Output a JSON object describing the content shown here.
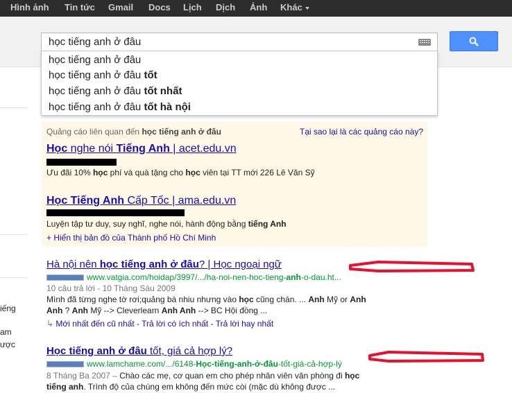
{
  "topnav": [
    {
      "label": "Hình ảnh"
    },
    {
      "label": "Tin tức"
    },
    {
      "label": "Gmail"
    },
    {
      "label": "Docs"
    },
    {
      "label": "Lịch"
    },
    {
      "label": "Dịch"
    },
    {
      "label": "Ảnh"
    },
    {
      "label": "Khác"
    }
  ],
  "search": {
    "value": "học tiếng anh ở đâu"
  },
  "suggestions": [
    {
      "base": "học tiếng anh ở đâu",
      "bold": ""
    },
    {
      "base": "học tiếng anh ở đâu ",
      "bold": "tốt"
    },
    {
      "base": "học tiếng anh ở đâu ",
      "bold": "tốt nhất"
    },
    {
      "base": "học tiếng anh ở đâu ",
      "bold": "tốt hà nội"
    }
  ],
  "left_fragments": [
    "iếng",
    "am",
    "ược"
  ],
  "ads": {
    "header_prefix": "Quảng cáo liên quan đến ",
    "header_query": "học tiếng anh ở đâu",
    "why": "Tại sao lại là các quảng cáo này?",
    "items": [
      {
        "t1": "Học",
        "t2": " nghe nói ",
        "t3": "Tiếng Anh",
        "t4": " | acet.edu.vn",
        "d1": "Ưu đãi 10% ",
        "d2": "học",
        "d3": " phí và quà tặng cho ",
        "d4": "học",
        "d5": " viên tại TT mới 226 Lê Văn Sỹ"
      },
      {
        "t1": "Học Tiếng Anh",
        "t2": " Cấp Tốc | ama.edu.vn",
        "d1": "Luyện tập tư duy, suy nghĩ, nghe nói, hành động bằng ",
        "d2": "tiếng Anh"
      }
    ],
    "map_link": "+ Hiển thị bản đồ của Thành phố Hồ Chí Minh"
  },
  "results": [
    {
      "title_a": "Hà nội nên ",
      "title_b": "học tiếng anh ở đâu",
      "title_c": "? | Học ngoại ngữ",
      "url_a": "www.vatgia.com/hoidap/3997/.../ha-noi-nen-hoc-tieng-",
      "url_b": "anh",
      "url_c": "-o-dau.ht...",
      "meta": "10 câu trả lời - 10 Tháng Sáu 2009",
      "s1a": "Mình đã từng nghe tờ rơi;quảng bá nhiu nhưng vào ",
      "s1b": "học",
      "s1c": " cũng chán. ... ",
      "s1d": "Anh",
      "s1e": " Mỹ or ",
      "s1f": "Anh",
      "s2a": "Anh",
      "s2b": " ? ",
      "s2c": "Anh",
      "s2d": " Mỹ --> Cleverlearn ",
      "s2e": "Anh Anh",
      "s2f": " --> BC Hội đồng ...",
      "links": "Mới nhất đến cũ nhất - Trả lời có ích nhất - Trả lời hay nhất"
    },
    {
      "title_a": "Học tiếng anh ở đâu",
      "title_b": " tốt, giá cả hợp lý?",
      "url_a": "www.lamchame.com/.../6148-",
      "url_b": "Học-tiếng-anh-ở-đâu",
      "url_c": "-tốt-giá-cả-hợp-lý",
      "s1a": "8 Tháng Ba 2007 – ",
      "s1b": "Chào các mẹ, cơ quan em cho phép nhân viên văn phòng đi ",
      "s1c": "học",
      "s2a": "tiếng anh",
      "s2b": ". Trình độ của chúng em không đến mức còi (mặc dù không được ..."
    }
  ],
  "colors": {
    "topbar": "#2d2d2d",
    "link": "#1a0dab",
    "url": "#009933",
    "ad_bg": "#fff8e7",
    "button": "#4d90fe",
    "annotation": "#e8102a"
  }
}
